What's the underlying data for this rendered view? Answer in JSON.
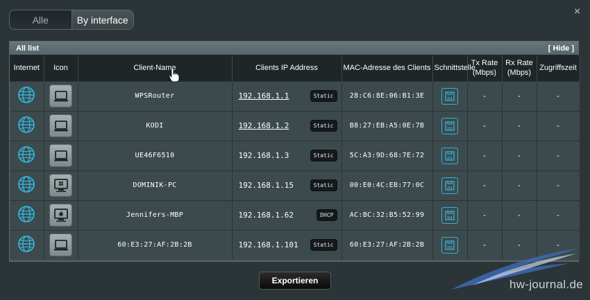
{
  "window": {
    "close_label": "×"
  },
  "view_toggle": {
    "options": [
      "Alle",
      "By interface"
    ],
    "selected": "By interface"
  },
  "panel": {
    "title": "All list",
    "hide_label": "[ Hide ]"
  },
  "columns": [
    "Internet",
    "Icon",
    "Client-Name",
    "Clients IP Address",
    "MAC-Adresse des Clients",
    "Schnittstelle",
    "Tx Rate (Mbps)",
    "Rx Rate (Mbps)",
    "Zugriffszeit"
  ],
  "clients": [
    {
      "name": "WPSRouter",
      "ip": "192.168.1.1",
      "ip_link": true,
      "ip_type": "Static",
      "mac": "28:C6:8E:06:B1:3E",
      "tx": "-",
      "rx": "-",
      "access_time": "-",
      "device_icon": "laptop-icon"
    },
    {
      "name": "KODI",
      "ip": "192.168.1.2",
      "ip_link": true,
      "ip_type": "Static",
      "mac": "B8:27:EB:A5:0E:7B",
      "tx": "-",
      "rx": "-",
      "access_time": "-",
      "device_icon": "laptop-icon"
    },
    {
      "name": "UE46F6510",
      "ip": "192.168.1.3",
      "ip_link": false,
      "ip_type": "Static",
      "mac": "5C:A3:9D:68:7E:72",
      "tx": "-",
      "rx": "-",
      "access_time": "-",
      "device_icon": "laptop-icon"
    },
    {
      "name": "DOMINIK-PC",
      "ip": "192.168.1.15",
      "ip_link": false,
      "ip_type": "Static",
      "mac": "00:E0:4C:EB:77:0C",
      "tx": "-",
      "rx": "-",
      "access_time": "-",
      "device_icon": "windows-pc-icon"
    },
    {
      "name": "Jennifers-MBP",
      "ip": "192.168.1.62",
      "ip_link": false,
      "ip_type": "DHCP",
      "mac": "AC:BC:32:B5:52:99",
      "tx": "-",
      "rx": "-",
      "access_time": "-",
      "device_icon": "apple-pc-icon"
    },
    {
      "name": "60:E3:27:AF:2B:2B",
      "ip": "192.168.1.101",
      "ip_link": false,
      "ip_type": "Static",
      "mac": "60:E3:27:AF:2B:2B",
      "tx": "-",
      "rx": "-",
      "access_time": "-",
      "device_icon": "laptop-icon"
    }
  ],
  "export_button": "Exportieren",
  "watermark": "hw-journal.de",
  "colors": {
    "accent": "#33b3d8",
    "background": "#2b3437",
    "header": "#1e2628",
    "row": "#3d4a4d"
  }
}
